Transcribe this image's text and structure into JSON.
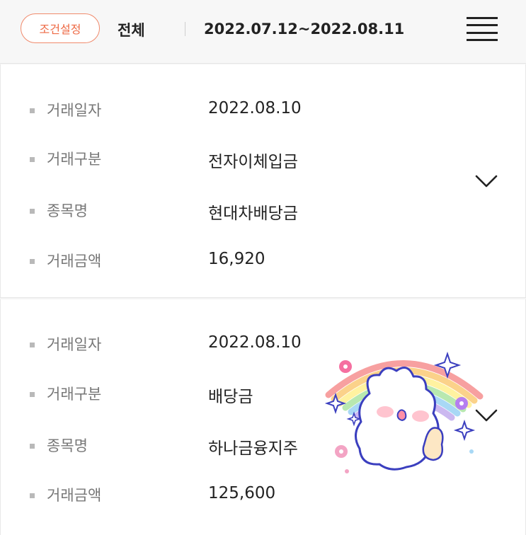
{
  "header": {
    "filter_button": "조건설정",
    "scope": "전체",
    "period": "2022.07.12~2022.08.11"
  },
  "transactions": [
    {
      "date_label": "거래일자",
      "date": "2022.08.10",
      "type_label": "거래구분",
      "type": "전자이체입금",
      "item_label": "종목명",
      "item": "현대차배당금",
      "amount_label": "거래금액",
      "amount": "16,920"
    },
    {
      "date_label": "거래일자",
      "date": "2022.08.10",
      "type_label": "거래구분",
      "type": "배당금",
      "item_label": "종목명",
      "item": "하나금융지주",
      "amount_label": "거래금액",
      "amount": "125,600"
    }
  ],
  "icons": {
    "menu": "hamburger-menu-icon",
    "expand": "chevron-down-icon",
    "sticker": "bunny-rainbow-sticker"
  },
  "colors": {
    "accent": "#ee6a45",
    "text": "#222222",
    "label": "#777777"
  }
}
